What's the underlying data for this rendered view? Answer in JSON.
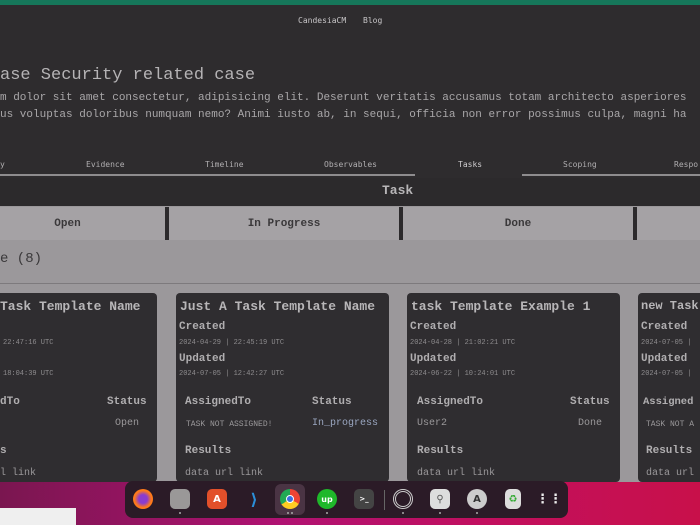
{
  "nav": {
    "brand": "CandesiaCM",
    "blog": "Blog"
  },
  "case": {
    "title": "ase Security related case",
    "desc1": "m dolor sit amet consectetur, adipisicing elit. Deserunt veritatis accusamus totam architecto asperiores",
    "desc2": "us voluptas doloribus numquam nemo? Animi iusto ab, in sequi, officia non error possimus culpa, magni ha"
  },
  "tabs": [
    "y",
    "Evidence",
    "Timeline",
    "Observables",
    "Tasks",
    "Scoping",
    "Respo"
  ],
  "task_header": "Task",
  "columns": [
    "Open",
    "In Progress",
    "Done"
  ],
  "count_label": "e (8)",
  "cards": [
    {
      "title": "Task Template Name",
      "created_label": "",
      "created": "22:47:16 UTC",
      "updated_label": "",
      "updated": "18:04:39 UTC",
      "assigned_label": "dTo",
      "status_label": "Status",
      "assigned": "",
      "status": "Open",
      "results_label": "s",
      "results": "l link"
    },
    {
      "title": "Just A Task Template Name",
      "created_label": "Created",
      "created": "2024-04-29 | 22:45:19 UTC",
      "updated_label": "Updated",
      "updated": "2024-07-05 | 12:42:27 UTC",
      "assigned_label": "AssignedTo",
      "status_label": "Status",
      "assigned": "TASK NOT ASSIGNED!",
      "status": "In_progress",
      "results_label": "Results",
      "results": "data url link"
    },
    {
      "title": "task Template Example 1",
      "created_label": "Created",
      "created": "2024-04-28 | 21:02:21 UTC",
      "updated_label": "Updated",
      "updated": "2024-06-22 | 10:24:01 UTC",
      "assigned_label": "AssignedTo",
      "status_label": "Status",
      "assigned": "User2",
      "status": "Done",
      "results_label": "Results",
      "results": "data url link"
    },
    {
      "title": "new Task",
      "created_label": "Created",
      "created": "2024-07-05 |",
      "updated_label": "Updated",
      "updated": "2024-07-05 |",
      "assigned_label": "Assigned",
      "status_label": "",
      "assigned": "TASK NOT A",
      "status": "",
      "results_label": "Results",
      "results": "data url"
    }
  ],
  "dock": {
    "apps": [
      "firefox",
      "files",
      "app-center",
      "vscode",
      "chrome",
      "upwork",
      "terminal",
      "disk-utility",
      "image-viewer",
      "software-updater",
      "trash",
      "show-apps"
    ],
    "upwork_label": "up"
  },
  "colors": {
    "accent": "#16775a",
    "card": "#2f2d30"
  }
}
